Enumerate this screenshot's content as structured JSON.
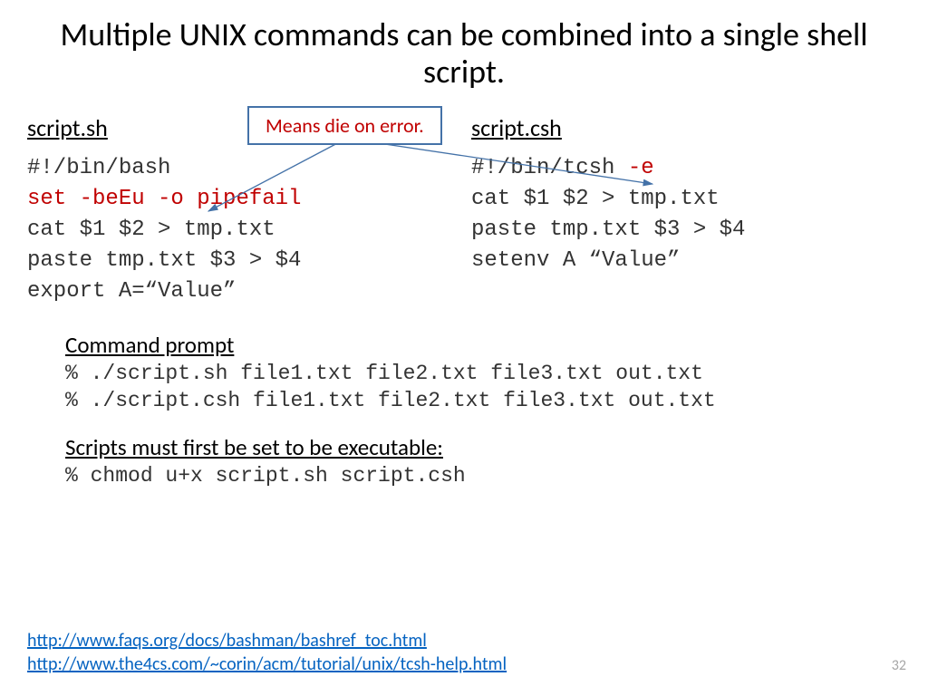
{
  "title": "Multiple UNIX commands can be combined into a single shell script.",
  "callout": "Means die on error.",
  "left": {
    "header": "script.sh",
    "l1": "#!/bin/bash",
    "l2": "set -beEu -o pipefail",
    "l3": "cat $1 $2 > tmp.txt",
    "l4": "paste tmp.txt $3 > $4",
    "l5": "export A=“Value”"
  },
  "right": {
    "header": "script.csh",
    "l1a": "#!/bin/tcsh ",
    "l1b": "-e",
    "l2": "cat $1 $2 > tmp.txt",
    "l3": "paste tmp.txt $3 > $4",
    "l4": "setenv A “Value”"
  },
  "cmd": {
    "header": "Command prompt",
    "l1": "% ./script.sh file1.txt file2.txt file3.txt out.txt",
    "l2": "% ./script.csh file1.txt file2.txt file3.txt out.txt"
  },
  "exec": {
    "header": "Scripts must first be set to be executable:",
    "l1": "% chmod u+x script.sh script.csh"
  },
  "links": {
    "l1": "http://www.faqs.org/docs/bashman/bashref_toc.html",
    "l2": "http://www.the4cs.com/~corin/acm/tutorial/unix/tcsh-help.html"
  },
  "page": "32"
}
